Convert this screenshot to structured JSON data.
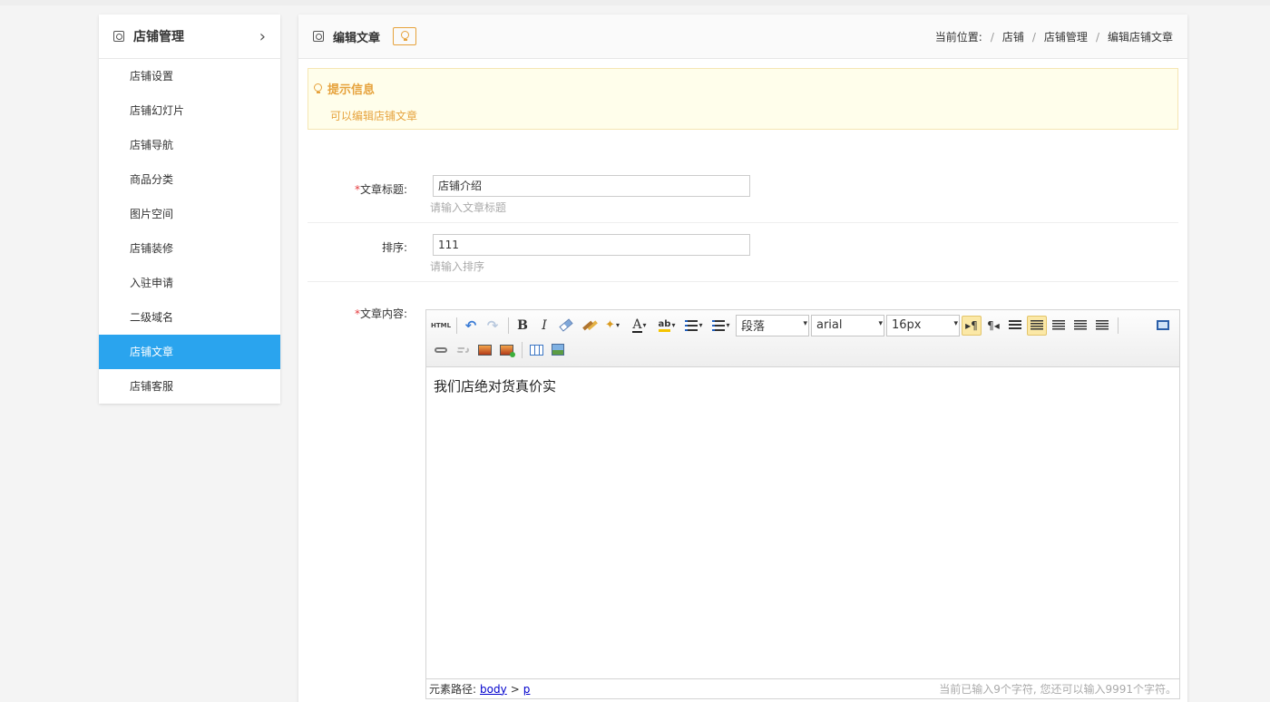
{
  "sidebar": {
    "title": "店铺管理",
    "items": [
      {
        "label": "店铺设置"
      },
      {
        "label": "店铺幻灯片"
      },
      {
        "label": "店铺导航"
      },
      {
        "label": "商品分类"
      },
      {
        "label": "图片空间"
      },
      {
        "label": "店铺装修"
      },
      {
        "label": "入驻申请"
      },
      {
        "label": "二级域名"
      },
      {
        "label": "店铺文章",
        "active": true
      },
      {
        "label": "店铺客服"
      }
    ]
  },
  "header": {
    "title": "编辑文章",
    "breadcrumb": {
      "prefix": "当前位置:",
      "separator": "/",
      "items": [
        "店铺",
        "店铺管理",
        "编辑店铺文章"
      ]
    }
  },
  "notice": {
    "title": "提示信息",
    "text": "可以编辑店铺文章"
  },
  "form": {
    "title_field": {
      "required_mark": "*",
      "label": "文章标题:",
      "value": "店铺介绍",
      "hint": "请输入文章标题"
    },
    "sort_field": {
      "label": "排序:",
      "value": "111",
      "hint": "请输入排序"
    },
    "content_field": {
      "required_mark": "*",
      "label": "文章内容:"
    }
  },
  "editor": {
    "html_label": "HTML",
    "paragraph_select": "段落",
    "font_select": "arial",
    "size_select": "16px",
    "content": "我们店绝对货真价实",
    "path_label": "元素路径:",
    "path_items": [
      "body",
      "p"
    ],
    "path_separator": ">",
    "char_count": "当前已输入9个字符, 您还可以输入9991个字符。"
  },
  "colors": {
    "accent": "#2aa4ee",
    "notice_text": "#e6a23c",
    "required": "#e4393c"
  }
}
